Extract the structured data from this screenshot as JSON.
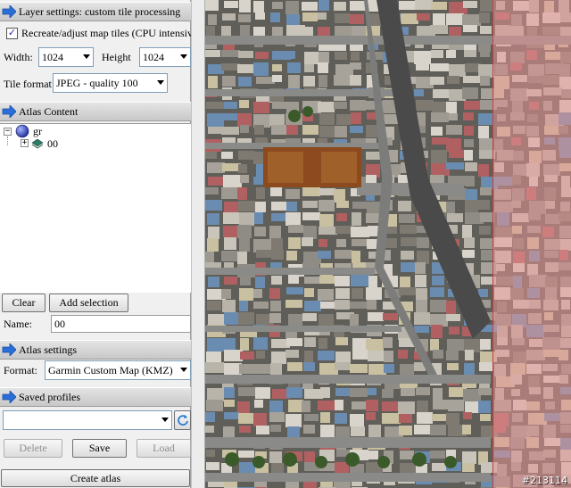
{
  "layer_settings": {
    "header": "Layer settings: custom tile processing",
    "recreate_label": "Recreate/adjust map tiles (CPU intensive)",
    "recreate_checked": true,
    "width_label": "Width:",
    "width_value": "1024",
    "height_label": "Height",
    "height_value": "1024",
    "format_label": "Tile format:",
    "format_value": "JPEG - quality 100"
  },
  "atlas_content": {
    "header": "Atlas Content",
    "tree": [
      {
        "label": "gr",
        "icon": "globe-icon",
        "expanded": true
      },
      {
        "label": "00",
        "icon": "layer-icon",
        "expanded": false
      }
    ],
    "clear_label": "Clear",
    "add_selection_label": "Add selection",
    "name_label": "Name:",
    "name_value": "00"
  },
  "atlas_settings": {
    "header": "Atlas settings",
    "format_label": "Format:",
    "format_value": "Garmin Custom Map (KMZ)"
  },
  "saved_profiles": {
    "header": "Saved profiles",
    "profile_value": "",
    "delete_label": "Delete",
    "save_label": "Save",
    "load_label": "Load"
  },
  "create_atlas_label": "Create atlas",
  "map": {
    "watermark": "#213114",
    "selection_color": "#e69696"
  },
  "colors": {
    "header_arrow": "#2a6ed8",
    "panel_bg": "#f0f0f0"
  }
}
